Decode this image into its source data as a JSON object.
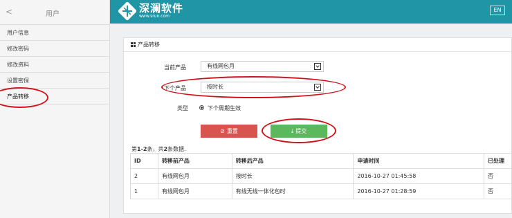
{
  "sidebar": {
    "back_icon": "chevron-left-icon",
    "back_glyph": "<",
    "title": "用户",
    "items": [
      {
        "label": "用户信息"
      },
      {
        "label": "修改密码"
      },
      {
        "label": "修改资料"
      },
      {
        "label": "设置密保"
      },
      {
        "label": "产品转移"
      }
    ]
  },
  "header": {
    "logo_name": "深澜软件",
    "logo_url": "www.srun.com",
    "lang_button": "EN",
    "color": "#1f95a6"
  },
  "panel": {
    "title": "产品转移",
    "current_product_label": "当前产品",
    "current_product_value": "有线网包月",
    "next_product_label": "下个产品",
    "next_product_value": "按时长",
    "type_label": "类型",
    "type_option": "下个周期生效",
    "reset_button": "重置",
    "submit_button": "提交"
  },
  "summary": {
    "prefix": "第",
    "range": "1-2",
    "middle": "条，共",
    "total": "2",
    "suffix": "条数据."
  },
  "table": {
    "headers": [
      "ID",
      "转移前产品",
      "转移后产品",
      "申请时间",
      "已处理"
    ],
    "rows": [
      [
        "2",
        "有线网包月",
        "按时长",
        "2016-10-27 01:45:58",
        "否"
      ],
      [
        "1",
        "有线网包月",
        "有线无线一体化包时",
        "2016-10-27 01:28:59",
        "否"
      ]
    ]
  },
  "colors": {
    "accent": "#1f95a6",
    "danger": "#d9534f",
    "success": "#5cb85c",
    "annotation": "#d0121b"
  }
}
